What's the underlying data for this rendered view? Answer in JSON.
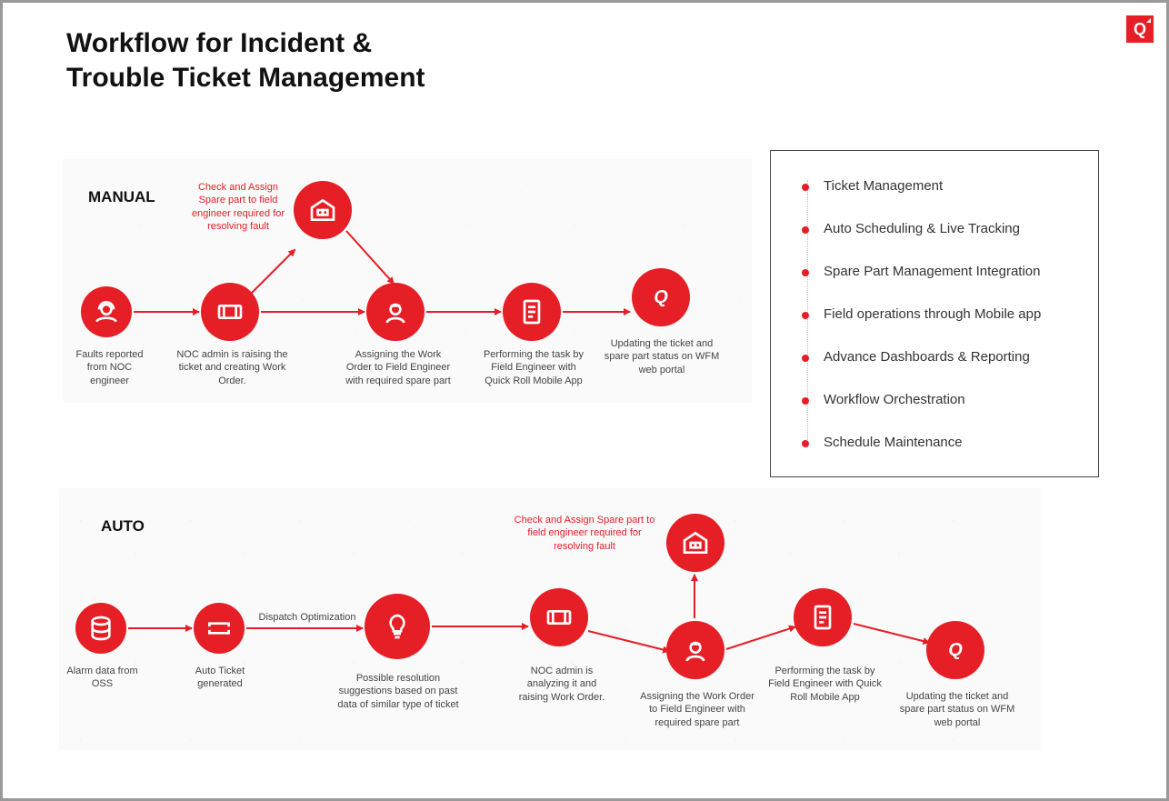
{
  "title_line1": "Workflow for Incident &",
  "title_line2": "Trouble Ticket Management",
  "logo_letter": "Q",
  "sections": {
    "manual": {
      "label": "MANUAL"
    },
    "auto": {
      "label": "AUTO"
    }
  },
  "features": [
    "Ticket Management",
    "Auto Scheduling & Live Tracking",
    "Spare Part Management Integration",
    "Field operations through Mobile app",
    "Advance Dashboards & Reporting",
    "Workflow Orchestration",
    "Schedule Maintenance"
  ],
  "manual_flow": {
    "spare_caption": "Check and Assign Spare part to field engineer required for resolving fault",
    "steps": [
      {
        "icon": "headset",
        "caption": "Faults reported from NOC engineer"
      },
      {
        "icon": "ticket",
        "caption": "NOC admin is raising the ticket and creating Work Order."
      },
      {
        "icon": "warehouse",
        "caption": ""
      },
      {
        "icon": "engineer",
        "caption": "Assigning the Work Order to Field Engineer with required spare part"
      },
      {
        "icon": "clipboard",
        "caption": "Performing the task by Field Engineer with Quick Roll Mobile App"
      },
      {
        "icon": "q",
        "caption": "Updating the ticket and spare part status on WFM web portal"
      }
    ]
  },
  "auto_flow": {
    "dispatch_label": "Dispatch Optimization",
    "spare_caption": "Check and Assign Spare part to field engineer required for resolving fault",
    "steps": [
      {
        "icon": "database",
        "caption": "Alarm data from OSS"
      },
      {
        "icon": "ticket2",
        "caption": "Auto Ticket generated"
      },
      {
        "icon": "bulb",
        "caption": "Possible resolution suggestions based on past data of similar type of ticket"
      },
      {
        "icon": "ticket",
        "caption": "NOC admin is analyzing it and raising Work Order."
      },
      {
        "icon": "warehouse",
        "caption": ""
      },
      {
        "icon": "engineer",
        "caption": "Assigning the Work Order to Field Engineer with required spare part"
      },
      {
        "icon": "clipboard",
        "caption": "Performing the task by Field Engineer with Quick Roll Mobile App"
      },
      {
        "icon": "q",
        "caption": "Updating the ticket and spare part status on WFM web portal"
      }
    ]
  },
  "colors": {
    "brand": "#e61e25"
  }
}
